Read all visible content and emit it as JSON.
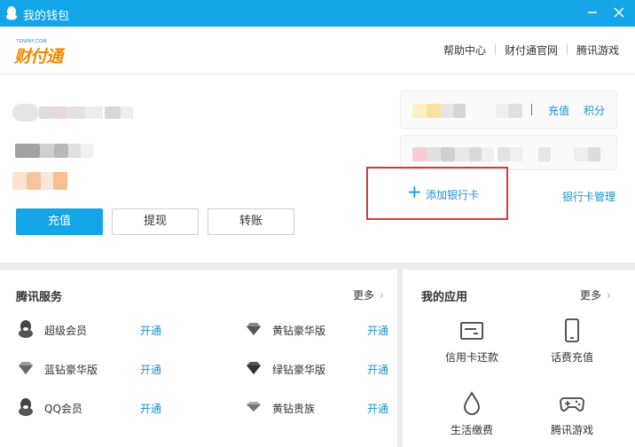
{
  "window": {
    "title": "我的钱包"
  },
  "header": {
    "logo_small": "TENPAY.COM",
    "logo_text": "财付通",
    "links": [
      "帮助中心",
      "财付通官网",
      "腾讯游戏"
    ]
  },
  "actions": {
    "recharge": "充值",
    "withdraw": "提现",
    "transfer": "转账"
  },
  "card": {
    "recharge": "充值",
    "points": "积分"
  },
  "bank": {
    "add": "添加银行卡",
    "manage": "银行卡管理"
  },
  "tencent_services": {
    "title": "腾讯服务",
    "more": "更多",
    "items": [
      {
        "name": "超级会员",
        "action": "开通",
        "icon": "penguin-icon"
      },
      {
        "name": "黄钻豪华版",
        "action": "开通",
        "icon": "diamond-icon"
      },
      {
        "name": "蓝钻豪华版",
        "action": "开通",
        "icon": "diamond-icon"
      },
      {
        "name": "绿钻豪华版",
        "action": "开通",
        "icon": "diamond-icon"
      },
      {
        "name": "QQ会员",
        "action": "开通",
        "icon": "penguin-icon"
      },
      {
        "name": "黄钻贵族",
        "action": "开通",
        "icon": "diamond-icon"
      }
    ]
  },
  "my_apps": {
    "title": "我的应用",
    "more": "更多",
    "items": [
      {
        "name": "信用卡还款",
        "icon": "credit-card-icon"
      },
      {
        "name": "话费充值",
        "icon": "phone-icon"
      },
      {
        "name": "生活缴费",
        "icon": "water-drop-icon"
      },
      {
        "name": "腾讯游戏",
        "icon": "gamepad-icon"
      }
    ]
  },
  "colors": {
    "titlebar": "#13a5e8",
    "link": "#1a92d5",
    "highlight_border": "#d83a3a",
    "logo": "#f08a00"
  }
}
